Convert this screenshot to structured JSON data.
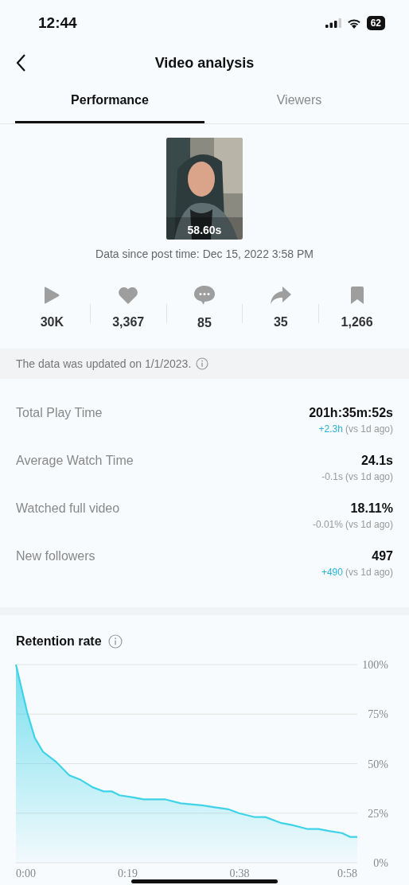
{
  "status_bar": {
    "time": "12:44",
    "battery": "62"
  },
  "header": {
    "title": "Video analysis"
  },
  "tabs": [
    {
      "label": "Performance",
      "selected": true
    },
    {
      "label": "Viewers",
      "selected": false
    }
  ],
  "video": {
    "kind": "picture",
    "duration": "58.60s",
    "post_time": "Data since post time: Dec 15, 2022 3:58 PM"
  },
  "stats": [
    {
      "kind": "play",
      "value": "30K"
    },
    {
      "kind": "like",
      "value": "3,367"
    },
    {
      "kind": "comment",
      "value": "85"
    },
    {
      "kind": "share",
      "value": "35"
    },
    {
      "kind": "save",
      "value": "1,266"
    }
  ],
  "update_notice": "The data was updated on 1/1/2023.",
  "metrics": [
    {
      "label": "Total Play Time",
      "value": "201h:35m:52s",
      "change": "+2.3h",
      "kind": "increase",
      "comparison": "(vs 1d ago)"
    },
    {
      "label": "Average Watch Time",
      "value": "24.1s",
      "change": "-0.1s",
      "kind": "decrease",
      "comparison": "(vs 1d ago)"
    },
    {
      "label": "Watched full video",
      "value": "18.11%",
      "change": "-0.01%",
      "kind": "decrease",
      "comparison": "(vs 1d ago)"
    },
    {
      "label": "New followers",
      "value": "497",
      "change": "+490",
      "kind": "increase",
      "comparison": "(vs 1d ago)"
    }
  ],
  "retention": {
    "title": "Retention rate",
    "chart_data": {
      "type": "area",
      "x": [
        0,
        1.9,
        3.2,
        4.6,
        6.8,
        9.1,
        10.9,
        13.1,
        14.9,
        16.3,
        17.6,
        19.9,
        21.7,
        25.3,
        28,
        31.6,
        33.8,
        36.1,
        37.9,
        40.6,
        42.4,
        45.1,
        46.9,
        49.6,
        51.4,
        53.2,
        55.4,
        56.8,
        58
      ],
      "grid": true,
      "series": [
        {
          "color": "#3fd3e8",
          "values": [
            100,
            76,
            63,
            56,
            51,
            44,
            42,
            38,
            36,
            36,
            34,
            33,
            32,
            32,
            30,
            29,
            28,
            27,
            25,
            23,
            23,
            20,
            19,
            17,
            17,
            16,
            15,
            13,
            13
          ]
        }
      ],
      "xlim": [
        0,
        58
      ],
      "ylim": [
        0,
        100
      ],
      "xticks": [
        {
          "value": 0,
          "label": "0:00"
        },
        {
          "value": 19,
          "label": "0:19"
        },
        {
          "value": 38,
          "label": "0:38"
        },
        {
          "value": 58,
          "label": "0:58"
        }
      ],
      "yticks": [
        {
          "value": 0,
          "label": "0%"
        },
        {
          "value": 25,
          "label": "25%"
        },
        {
          "value": 50,
          "label": "50%"
        },
        {
          "value": 75,
          "label": "75%"
        },
        {
          "value": 100,
          "label": "100%"
        }
      ]
    }
  }
}
